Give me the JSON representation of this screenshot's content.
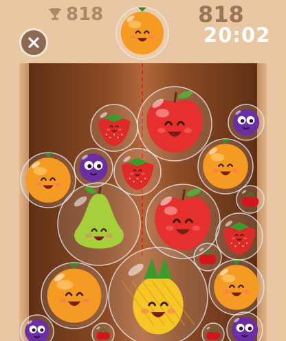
{
  "hud": {
    "best_score": "818",
    "score": "818",
    "timer": "20:02",
    "best_icon": "trophy-icon",
    "close_icon": "close-icon"
  },
  "next_fruit": "orange",
  "board": {
    "fruits": [
      {
        "kind": "orange"
      },
      {
        "kind": "strawberry"
      },
      {
        "kind": "apple"
      },
      {
        "kind": "grape"
      },
      {
        "kind": "orange"
      },
      {
        "kind": "grape"
      },
      {
        "kind": "strawberry"
      },
      {
        "kind": "orange"
      },
      {
        "kind": "pear"
      },
      {
        "kind": "apple"
      },
      {
        "kind": "cherry"
      },
      {
        "kind": "strawberry"
      },
      {
        "kind": "cherry"
      },
      {
        "kind": "orange"
      },
      {
        "kind": "pineapple"
      },
      {
        "kind": "orange"
      },
      {
        "kind": "grape"
      },
      {
        "kind": "cherry"
      },
      {
        "kind": "cherry"
      },
      {
        "kind": "grape"
      }
    ]
  },
  "colors": {
    "orange": "#f59a22",
    "apple": "#e5302e",
    "strawberry": "#df2a2a",
    "grape": "#6a2fa3",
    "pear": "#a6cf3c",
    "pineapple": "#f5c625",
    "cherry": "#d7131c"
  }
}
